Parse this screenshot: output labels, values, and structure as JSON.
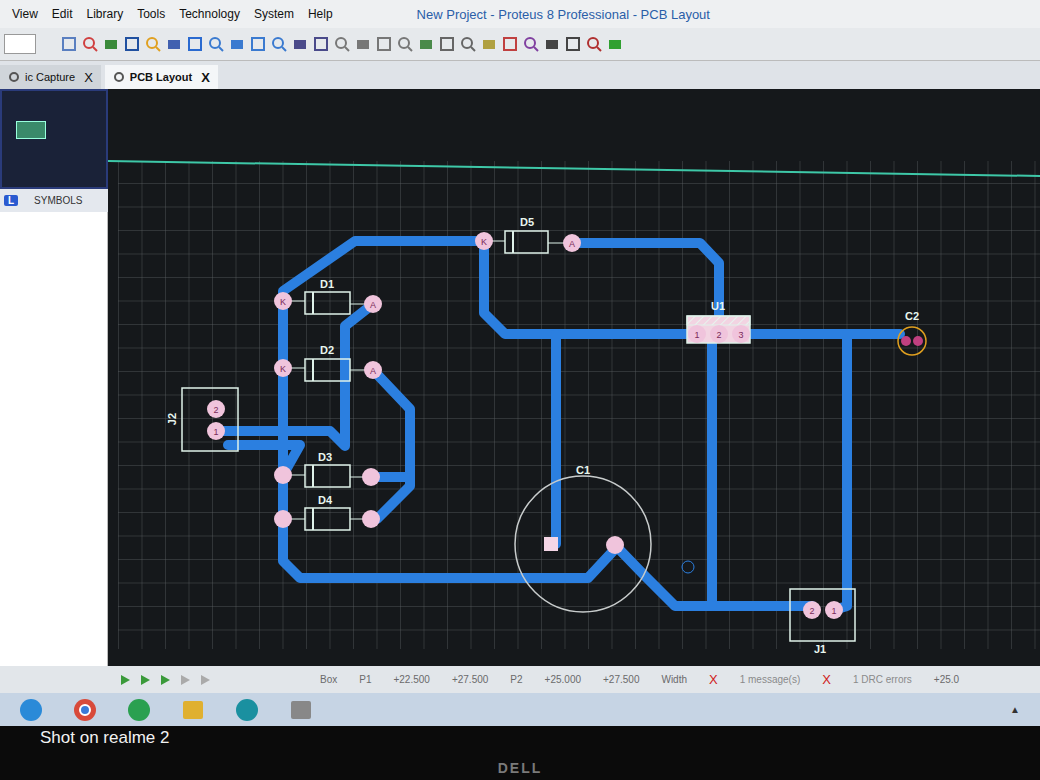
{
  "window": {
    "title": "New Project - Proteus 8 Professional - PCB Layout"
  },
  "menu": [
    "View",
    "Edit",
    "Library",
    "Tools",
    "Technology",
    "System",
    "Help"
  ],
  "tabs": [
    {
      "label": "ic Capture",
      "selected": false,
      "close": "X"
    },
    {
      "label": "PCB Layout",
      "selected": true,
      "close": "X"
    }
  ],
  "sidebar": {
    "badge": "L",
    "header": "SYMBOLS"
  },
  "pcb": {
    "components": [
      {
        "ref": "D5",
        "kind": "diode",
        "pins": [
          "K",
          "A"
        ]
      },
      {
        "ref": "D1",
        "kind": "diode",
        "pins": [
          "K",
          "A"
        ]
      },
      {
        "ref": "D2",
        "kind": "diode",
        "pins": [
          "K",
          "A"
        ]
      },
      {
        "ref": "D3",
        "kind": "diode",
        "pins": [
          "",
          ""
        ]
      },
      {
        "ref": "D4",
        "kind": "diode",
        "pins": [
          "",
          ""
        ]
      },
      {
        "ref": "J2",
        "kind": "connector",
        "pins": [
          "2",
          "1"
        ]
      },
      {
        "ref": "U1",
        "kind": "regulator",
        "pins": [
          "1",
          "2",
          "3"
        ]
      },
      {
        "ref": "C1",
        "kind": "capacitor",
        "pins": [
          "",
          ""
        ]
      },
      {
        "ref": "C2",
        "kind": "capacitor",
        "pins": [
          "",
          ""
        ]
      },
      {
        "ref": "J1",
        "kind": "connector",
        "pins": [
          "2",
          "1"
        ]
      }
    ]
  },
  "status_bar": {
    "fields": [
      {
        "text": "Box",
        "kind": "label"
      },
      {
        "text": "P1",
        "kind": "label"
      },
      {
        "text": "+22.500",
        "kind": "value"
      },
      {
        "text": "+27.500",
        "kind": "value"
      },
      {
        "text": "P2",
        "kind": "label"
      },
      {
        "text": "+25.000",
        "kind": "value"
      },
      {
        "text": "+27.500",
        "kind": "value"
      },
      {
        "text": "Width",
        "kind": "label"
      },
      {
        "text": "X",
        "kind": "error"
      },
      {
        "text": "1 message(s)",
        "kind": "muted"
      },
      {
        "text": "X",
        "kind": "error"
      },
      {
        "text": "1 DRC errors",
        "kind": "muted"
      },
      {
        "text": "+25.0",
        "kind": "value"
      }
    ]
  },
  "taskbar": {
    "tray_glyph": "▲"
  },
  "watermark": "Shot on realme 2",
  "monitor": {
    "brand": "DELL"
  }
}
